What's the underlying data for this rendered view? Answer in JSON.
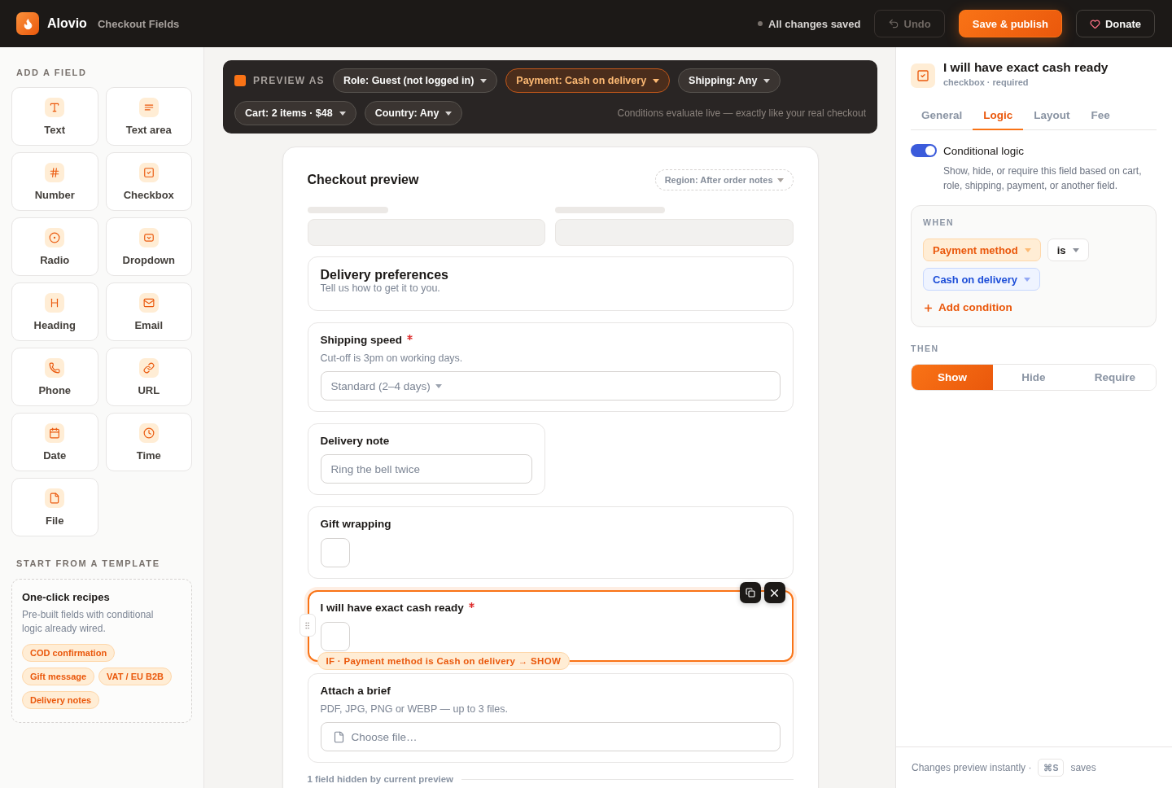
{
  "topbar": {
    "brand": "Alovio",
    "page_title": "Checkout Fields",
    "save_status": "All changes saved",
    "buttons": [
      {
        "kind": "undo",
        "label": "Undo",
        "disabled": true
      },
      {
        "kind": "primary",
        "label": "Save & publish",
        "disabled": false
      },
      {
        "kind": "donate",
        "label": "Donate",
        "disabled": false
      }
    ]
  },
  "sidebar": {
    "heading": "ADD A FIELD",
    "field_types": [
      {
        "kind": "text",
        "label": "Text"
      },
      {
        "kind": "textarea",
        "label": "Text area"
      },
      {
        "kind": "number",
        "label": "Number"
      },
      {
        "kind": "checkbox",
        "label": "Checkbox"
      },
      {
        "kind": "radio",
        "label": "Radio"
      },
      {
        "kind": "dropdown",
        "label": "Dropdown"
      },
      {
        "kind": "heading",
        "label": "Heading"
      },
      {
        "kind": "email",
        "label": "Email"
      },
      {
        "kind": "phone",
        "label": "Phone"
      },
      {
        "kind": "url",
        "label": "URL"
      },
      {
        "kind": "date",
        "label": "Date"
      },
      {
        "kind": "time",
        "label": "Time"
      },
      {
        "kind": "file",
        "label": "File"
      }
    ],
    "template_heading": "START FROM A TEMPLATE",
    "template": {
      "title": "One-click recipes",
      "description": "Pre-built fields with conditional logic already wired.",
      "recipes": [
        "COD confirmation",
        "Gift message",
        "VAT / EU B2B",
        "Delivery notes"
      ]
    }
  },
  "preview_bar": {
    "label": "PREVIEW AS",
    "rows": [
      {
        "filters": [
          {
            "label": "Role: Guest (not logged in)",
            "selected": false
          },
          {
            "label": "Payment: Cash on delivery",
            "selected": true
          },
          {
            "label": "Shipping: Any",
            "selected": false
          }
        ]
      },
      {
        "filters": [
          {
            "label": "Cart: 2 items · $48",
            "selected": false
          },
          {
            "label": "Country: Any",
            "selected": false
          }
        ]
      }
    ],
    "note": "Conditions evaluate live — exactly like your real checkout"
  },
  "checkout": {
    "title": "Checkout preview",
    "region": "Region: After order notes",
    "fields": [
      {
        "kind": "section",
        "title": "Delivery preferences",
        "description": "Tell us how to get it to you.",
        "selected": false
      },
      {
        "kind": "select",
        "label": "Shipping speed",
        "required": true,
        "help": "Cut-off is 3pm on working days.",
        "value": "Standard (2–4 days)",
        "selected": false
      },
      {
        "kind": "text",
        "label": "Delivery note",
        "required": false,
        "placeholder": "Ring the bell twice",
        "selected": false
      },
      {
        "kind": "checkbox",
        "label": "Gift wrapping",
        "required": false,
        "checked": false,
        "selected": false
      },
      {
        "kind": "checkbox",
        "label": "I will have exact cash ready",
        "required": true,
        "checked": false,
        "selected": true,
        "condition": "IF · Payment method is Cash on delivery → SHOW"
      },
      {
        "kind": "file",
        "label": "Attach a brief",
        "required": false,
        "help": "PDF, JPG, PNG or WEBP — up to 3 files.",
        "placeholder": "Choose file…",
        "selected": false
      }
    ],
    "hidden_note": "1 field hidden by current preview"
  },
  "inspector": {
    "title": "I will have exact cash ready",
    "subtitle": "checkbox · required",
    "tabs": [
      {
        "label": "General",
        "selected": false
      },
      {
        "label": "Logic",
        "selected": true
      },
      {
        "label": "Layout",
        "selected": false
      },
      {
        "label": "Fee",
        "selected": false
      }
    ],
    "logic": {
      "label": "Conditional logic",
      "on": true,
      "description": "Show, hide, or require this field based on cart, role, shipping, payment, or another field."
    },
    "when": {
      "heading": "WHEN",
      "field": "Payment method",
      "operator": "is",
      "value": "Cash on delivery",
      "add_label": "Add condition"
    },
    "then": {
      "heading": "THEN",
      "options": [
        {
          "label": "Show",
          "selected": true
        },
        {
          "label": "Hide",
          "selected": false
        },
        {
          "label": "Require",
          "selected": false
        }
      ]
    },
    "footer": {
      "text": "Changes preview instantly ·",
      "shortcut": "⌘S",
      "suffix": "saves"
    }
  }
}
